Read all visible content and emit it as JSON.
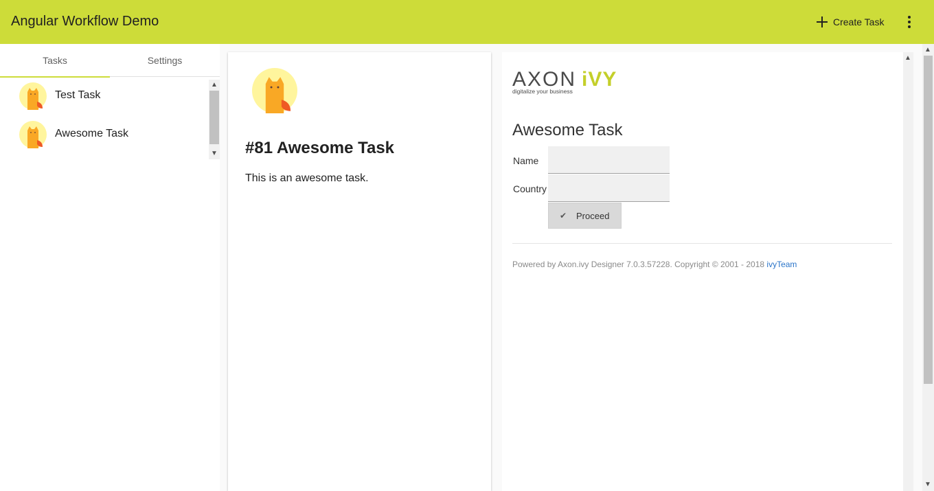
{
  "app": {
    "title": "Angular Workflow Demo"
  },
  "toolbar": {
    "create_label": "Create Task"
  },
  "sidebar": {
    "tabs": [
      {
        "label": "Tasks"
      },
      {
        "label": "Settings"
      }
    ],
    "tasks": [
      {
        "name": "Test Task"
      },
      {
        "name": "Awesome Task"
      }
    ]
  },
  "detail": {
    "heading": "#81 Awesome Task",
    "description": "This is an awesome task."
  },
  "form": {
    "logo_text": "AXON iVY",
    "logo_tagline": "digitalize your business",
    "title": "Awesome Task",
    "name_label": "Name",
    "name_value": "",
    "country_label": "Country",
    "country_value": "",
    "proceed_label": "Proceed",
    "footer_text": "Powered by Axon.ivy Designer 7.0.3.57228. Copyright © 2001 - 2018",
    "footer_link": "ivyTeam"
  },
  "colors": {
    "accent": "#cddc39",
    "link": "#2a74c9"
  }
}
